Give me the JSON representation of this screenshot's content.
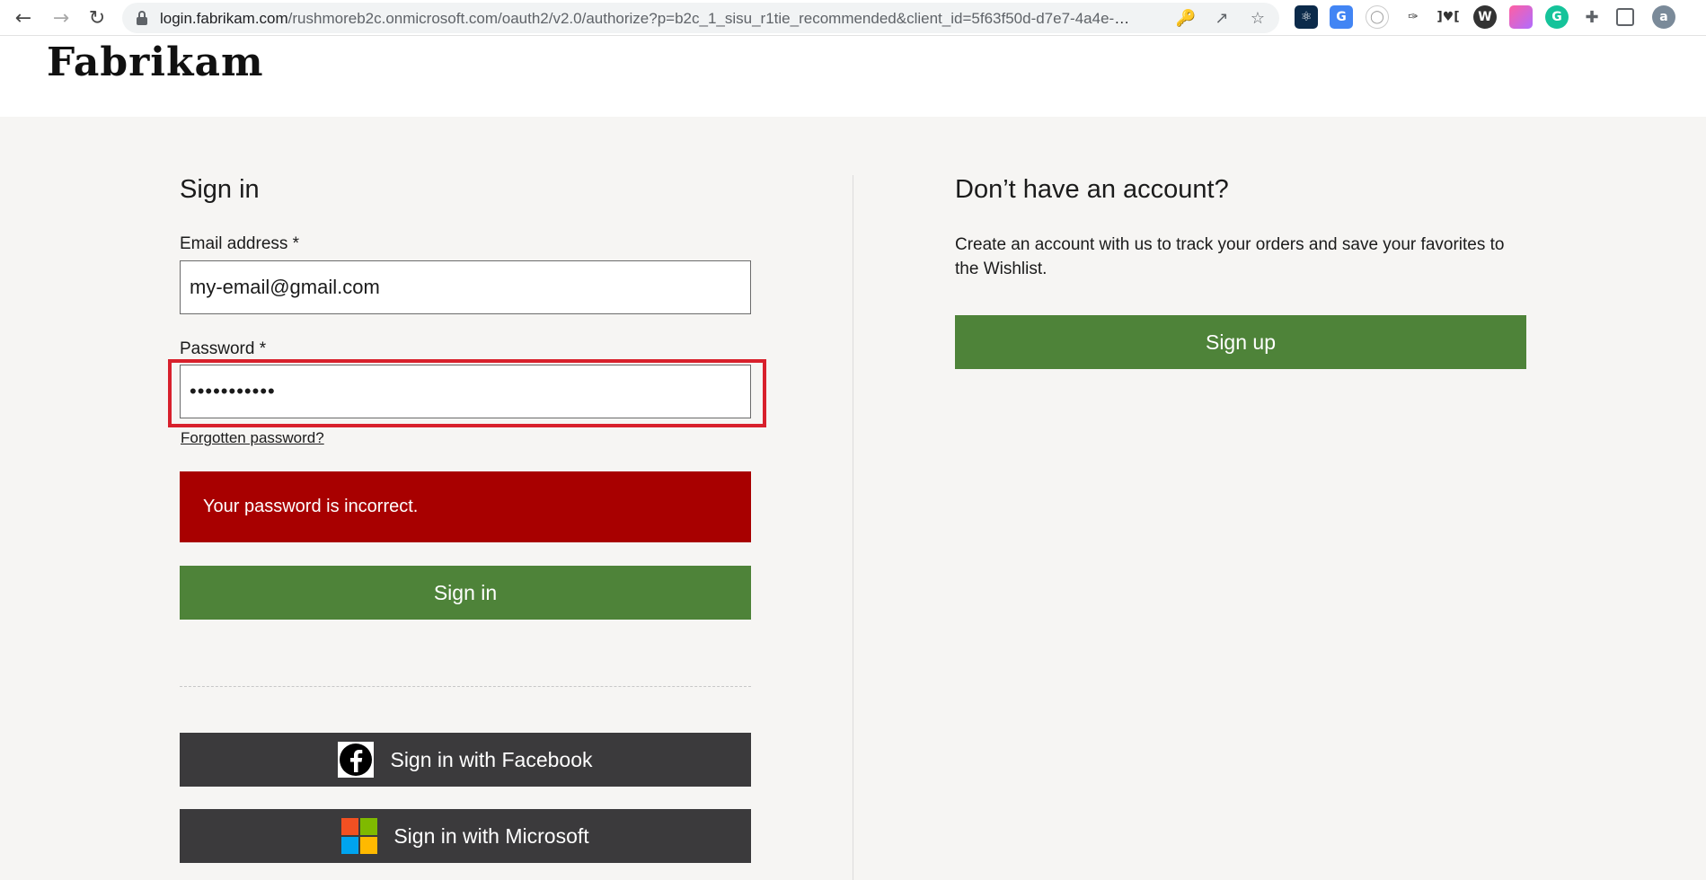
{
  "browser": {
    "url_host": "login.fabrikam.com",
    "url_path": "/rushmoreb2c.onmicrosoft.com/oauth2/v2.0/authorize?p=b2c_1_sisu_r1tie_recommended&client_id=5f63f50d-d7e7-4a4e-8...",
    "profile_initial": "a"
  },
  "header": {
    "logo": "Fabrikam"
  },
  "signin": {
    "title": "Sign in",
    "email_label": "Email address *",
    "email_value": "my-email@gmail.com",
    "password_label": "Password *",
    "password_value": "•••••••••••",
    "forgot_link": "Forgotten password?",
    "error_message": "Your password is incorrect.",
    "signin_button": "Sign in",
    "facebook_button": "Sign in with Facebook",
    "microsoft_button": "Sign in with Microsoft"
  },
  "signup": {
    "title": "Don’t have an account?",
    "description": "Create an account with us to track your orders and save your favorites to the Wishlist.",
    "signup_button": "Sign up"
  },
  "colors": {
    "primary_green": "#4e8339",
    "error_red": "#a80000",
    "highlight_red": "#d8202c",
    "social_dark": "#3b3a3c"
  }
}
